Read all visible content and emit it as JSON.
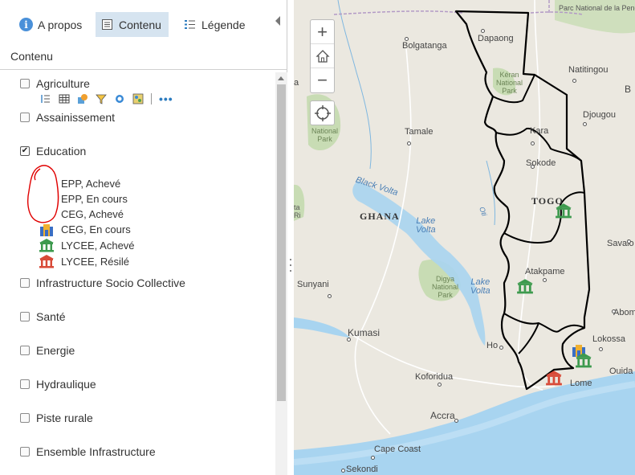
{
  "tabs": {
    "about": "A propos",
    "content": "Contenu",
    "legend": "Légende"
  },
  "section_title": "Contenu",
  "layers": [
    {
      "label": "Agriculture",
      "checked": false
    },
    {
      "label": "Assainissement",
      "checked": false
    },
    {
      "label": "Education",
      "checked": true
    },
    {
      "label": "Infrastructure Socio Collective",
      "checked": false
    },
    {
      "label": "Santé",
      "checked": false
    },
    {
      "label": "Energie",
      "checked": false
    },
    {
      "label": "Hydraulique",
      "checked": false
    },
    {
      "label": "Piste rurale",
      "checked": false
    },
    {
      "label": "Ensemble Infrastructure",
      "checked": false
    }
  ],
  "education_legend": [
    {
      "label": "EPP, Achevé",
      "icon": "school-complete-icon"
    },
    {
      "label": "EPP, En cours",
      "icon": "school-inprogress-icon"
    },
    {
      "label": "CEG, Achevé",
      "icon": "college-complete-icon"
    },
    {
      "label": "CEG, En cours",
      "icon": "college-inprogress-icon"
    },
    {
      "label": "LYCEE, Achevé",
      "icon": "highschool-complete-icon"
    },
    {
      "label": "LYCEE, Résilé",
      "icon": "highschool-cancelled-icon"
    }
  ],
  "toolbar_icons": [
    "sort-icon",
    "table-icon",
    "symbol-icon",
    "filter-icon",
    "cluster-icon",
    "map-style-icon"
  ],
  "map": {
    "controls": {
      "zoom_in": "+",
      "home": "⌂",
      "zoom_out": "−"
    },
    "labels": {
      "pendjari": "Parc\nNational de\nla Pendjari",
      "dapaong": "Dapaong",
      "bolgatanga": "Bolgatanga",
      "natitingou": "Natitingou",
      "keran": "Kéran\nNational\nPark",
      "national_park_left": "National\nPark",
      "tamale": "Tamale",
      "kara": "Kara",
      "djougou": "Djougou",
      "sokode": "Sokode",
      "black_volta": "Black Volta",
      "oti": "Oti",
      "togo": "TOGO",
      "ghana": "GHANA",
      "lake_volta_1": "Lake\nVolta",
      "savalo": "Savalo",
      "atakpame": "Atakpame",
      "digya": "Digya\nNational\nPark",
      "lake_volta_2": "Lake\nVolta",
      "sunyani": "Sunyani",
      "abomey": "Abom",
      "kumasi": "Kumasi",
      "ho": "Ho",
      "lokossa": "Lokossa",
      "koforidua": "Koforidua",
      "ouida": "Ouida",
      "lome": "Lome",
      "accra": "Accra",
      "cape_coast": "Cape Coast",
      "sekondi": "Sekondi",
      "left_edge_a": "a",
      "left_edge_tarin": "ta\nRi",
      "b_edge": "B"
    }
  },
  "colors": {
    "tab_active_bg": "#d6e4f0",
    "accent": "#2b7bbf",
    "map_land": "#ebe8e0",
    "map_sea": "#a8d4f0",
    "park": "#c8dcb4",
    "border": "#000000",
    "annotation_red": "#e00000"
  }
}
